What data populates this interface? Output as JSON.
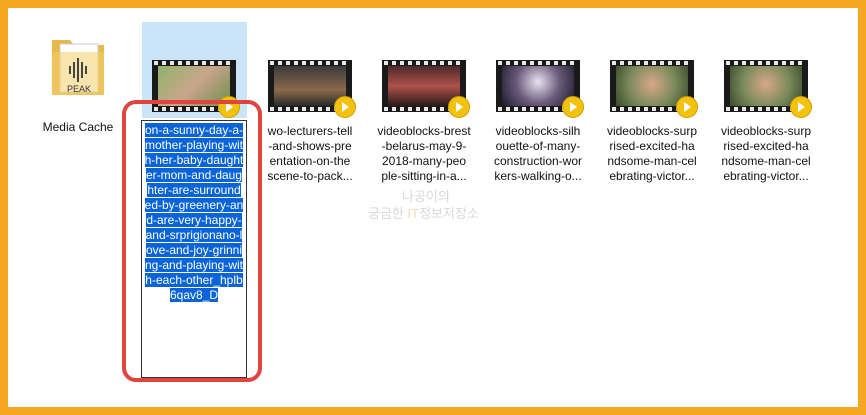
{
  "folder": {
    "name": "Media Cache",
    "icon_text": "PEAK",
    "icon": "folder-icon"
  },
  "selected": {
    "name_text": "on-a-sunny-day-a-mother-playing-with-her-baby-daughter-mom-and-daughter-are-surrounded-by-greenery-and-are-very-happy-and-srprigionano-love-and-joy-grinning-and-playing-with-each-other_hplb6qav8_D"
  },
  "files": [
    {
      "label": "wo-lecturers-tell\n-and-shows-pre\nentation-on-the\nscene-to-pack..."
    },
    {
      "label": "videoblocks-brest\n-belarus-may-9-\n2018-many-peo\nple-sitting-in-a..."
    },
    {
      "label": "videoblocks-silh\nouette-of-many-\nconstruction-wor\nkers-walking-o..."
    },
    {
      "label": "videoblocks-surp\nrised-excited-ha\nndsome-man-cel\nebrating-victor..."
    },
    {
      "label": "videoblocks-surp\nrised-excited-ha\nndsome-man-cel\nebrating-victor..."
    }
  ],
  "watermark": {
    "line1": "나공이의",
    "line2_a": "궁금한 ",
    "line2_b": "IT",
    "line2_c": "정보저장소"
  },
  "colors": {
    "selection": "#0a64d8",
    "highlight_border": "#e0443e",
    "frame": "#f5a623"
  }
}
